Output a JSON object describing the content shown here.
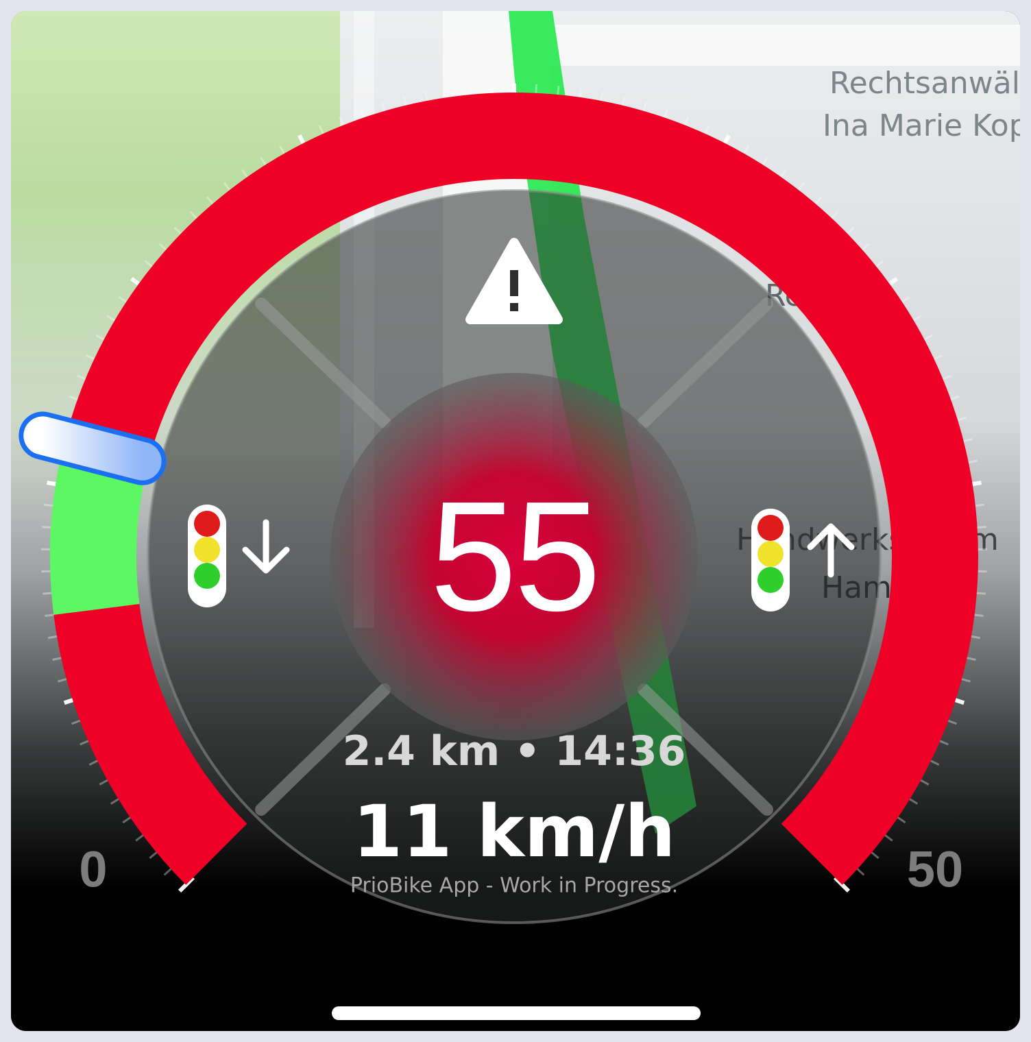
{
  "map": {
    "labels": [
      "Rechtsanwält",
      "Ina Marie Kop",
      "Re",
      "Handwerkskamm",
      "Ham"
    ]
  },
  "gauge": {
    "current_recommendation": "55",
    "min_label": "0",
    "max_label": "50",
    "distance_time": "2.4 km • 14:36",
    "speed": "11 km/h",
    "footer": "PrioBike App - Work in Progress.",
    "warning_icon": "warning-triangle-icon",
    "left_action_icon": "traffic-light-down-icon",
    "right_action_icon": "traffic-light-up-icon",
    "arc_segments": [
      {
        "from_kmh": 0,
        "to_kmh": 7,
        "color": "#ee0027"
      },
      {
        "from_kmh": 7,
        "to_kmh": 11,
        "color": "#5cf762"
      },
      {
        "from_kmh": 11,
        "to_kmh": 50,
        "color": "#ee0027"
      }
    ],
    "speed_indicator_kmh": 11
  },
  "colors": {
    "red": "#ee0027",
    "green": "#5cf762",
    "route": "#22e84a",
    "indicator": "#4f8df5"
  }
}
